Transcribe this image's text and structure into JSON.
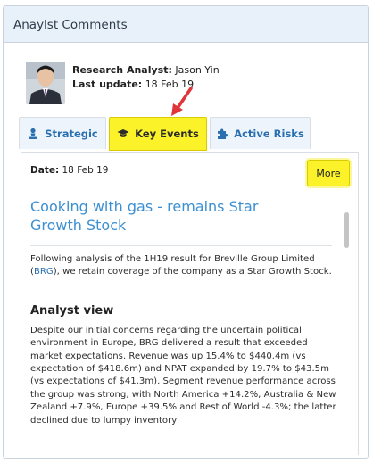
{
  "panel": {
    "title": "Anaylst Comments"
  },
  "analyst": {
    "role_label": "Research Analyst:",
    "name": "Jason Yin",
    "update_label": "Last update:",
    "update_date": "18 Feb 19",
    "photo_icon": "analyst-photo"
  },
  "tabs": [
    {
      "label": "Strategic",
      "icon": "chess-pawn-icon"
    },
    {
      "label": "Key Events",
      "icon": "graduation-cap-icon",
      "active": true
    },
    {
      "label": "Active Risks",
      "icon": "puzzle-icon"
    }
  ],
  "content": {
    "date_label": "Date:",
    "date": "18 Feb 19",
    "more_label": "More",
    "title": "Cooking with gas - remains Star Growth Stock",
    "intro_before": "Following analysis of the 1H19 result for Breville Group Limited (",
    "intro_link": "BRG",
    "intro_after": "), we retain coverage of the company as a Star Growth Stock.",
    "section_heading": "Analyst view",
    "section_body": "Despite our initial concerns regarding the uncertain political environment in Europe, BRG delivered a result that exceeded market expectations. Revenue was up 15.4% to $440.4m (vs expectation of $418.6m) and NPAT expanded by 19.7% to $43.5m (vs expectations of $41.3m). Segment revenue performance across the group was strong, with North America +14.2%, Australia & New Zealand +7.9%, Europe +39.5% and Rest of World -4.3%; the latter declined due to lumpy inventory"
  },
  "colors": {
    "accent_yellow": "#fbf229",
    "link_blue": "#3c8fd1",
    "header_bg": "#e8f1fa",
    "arrow_red": "#e0363a"
  }
}
